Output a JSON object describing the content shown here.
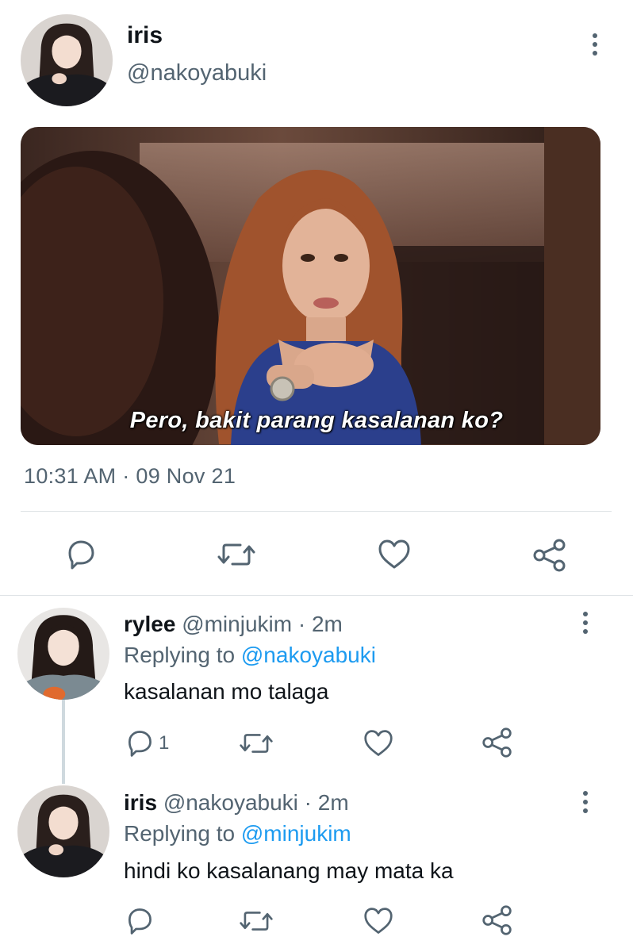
{
  "main_tweet": {
    "display_name": "iris",
    "handle": "@nakoyabuki",
    "media_caption": "Pero, bakit parang kasalanan ko?",
    "timestamp": "10:31 AM · 09 Nov 21",
    "actions": [
      "reply-icon",
      "retweet-icon",
      "like-icon",
      "share-icon"
    ]
  },
  "replies": [
    {
      "display_name": "rylee",
      "handle": "@minjukim",
      "separator": "·",
      "time": "2m",
      "replying_label": "Replying to",
      "replying_to": "@nakoyabuki",
      "text": "kasalanan mo talaga",
      "reply_count": "1"
    },
    {
      "display_name": "iris",
      "handle": "@nakoyabuki",
      "separator": "·",
      "time": "2m",
      "replying_label": "Replying to",
      "replying_to": "@minjukim",
      "text": "hindi ko kasalanang may mata ka",
      "reply_count": ""
    }
  ],
  "colors": {
    "primary_text": "#0f1419",
    "secondary_text": "#536471",
    "link": "#1d9bf0",
    "divider": "#dfe3e6"
  }
}
